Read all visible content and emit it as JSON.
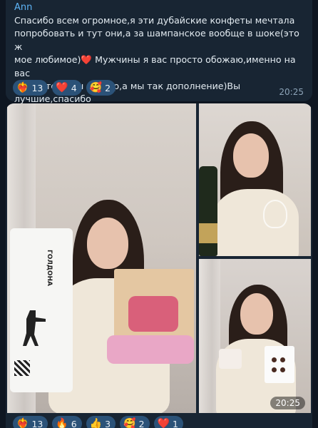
{
  "message1": {
    "sender": "Ann",
    "text": "Спасибо всем огромное,я эти дубайские конфеты мечтала\nпопробовать и тут они,а за шампанское вообще в шоке(это ж\nмое любимое)❤️ Мужчины я вас просто обожаю,именно на вас\nдержится наш сервер,а мы так дополнение)Вы лучшие,спасибо\nогромное за такие подарки🥰😘😘😘😘",
    "time": "20:25",
    "reactions": [
      {
        "emoji": "❤️‍🔥",
        "count": "13"
      },
      {
        "emoji": "❤️",
        "count": "4"
      },
      {
        "emoji": "🥰",
        "count": "2"
      }
    ]
  },
  "message2": {
    "time": "20:25",
    "bag_text": "ГОЛДОНА",
    "reactions": [
      {
        "emoji": "❤️‍🔥",
        "count": "13"
      },
      {
        "emoji": "🔥",
        "count": "6"
      },
      {
        "emoji": "👍",
        "count": "3"
      },
      {
        "emoji": "🥰",
        "count": "2"
      },
      {
        "emoji": "❤️",
        "count": "1"
      }
    ]
  },
  "colors": {
    "background": "#0e1621",
    "bubble": "#182533",
    "accent": "#5eb5f7",
    "chip": "#2b5278"
  }
}
